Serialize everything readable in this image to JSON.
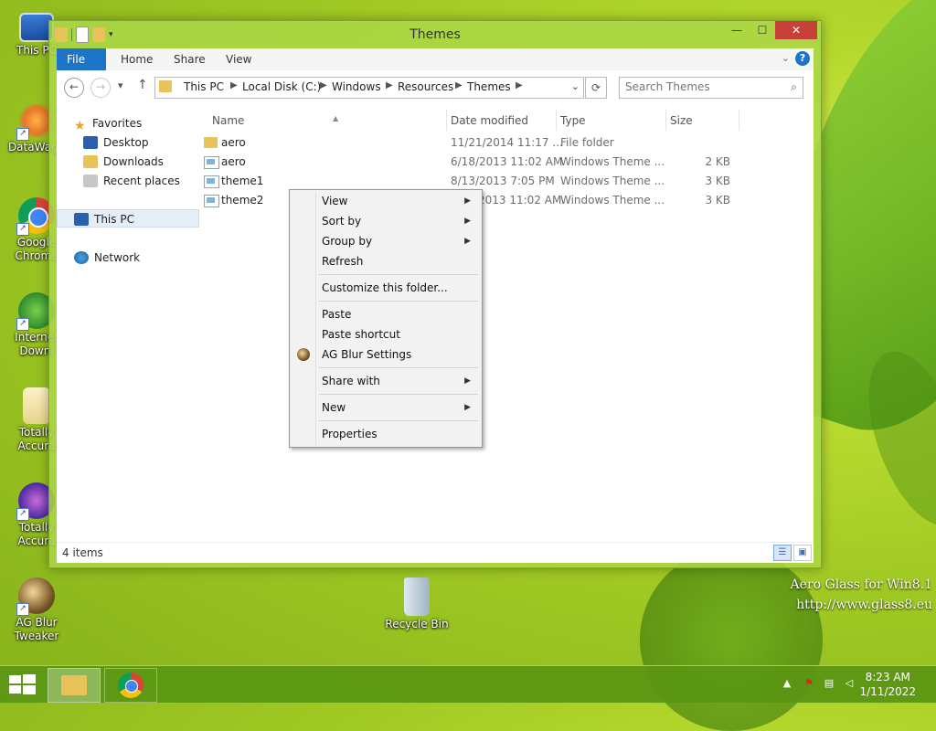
{
  "desktop": {
    "icons": [
      {
        "label": "This PC"
      },
      {
        "label": "DataWage"
      },
      {
        "label": "Google Chrome"
      },
      {
        "label": "Internet Downl"
      },
      {
        "label": "Totally Accura"
      },
      {
        "label": "Totally Accura"
      },
      {
        "label": "AG Blur Tweaker"
      },
      {
        "label": "Recycle Bin"
      }
    ],
    "watermark_line1": "Aero Glass for Win8.1",
    "watermark_line2": "http://www.glass8.eu"
  },
  "window": {
    "title": "Themes",
    "controls": {
      "minimize": "—",
      "maximize": "☐",
      "close": "✕"
    }
  },
  "ribbon": {
    "tabs": [
      "File",
      "Home",
      "Share",
      "View"
    ],
    "help": "?"
  },
  "addressbar": {
    "crumbs": [
      "This PC",
      "Local Disk (C:)",
      "Windows",
      "Resources",
      "Themes"
    ],
    "search_placeholder": "Search Themes"
  },
  "navpane": {
    "favorites": "Favorites",
    "desktop": "Desktop",
    "downloads": "Downloads",
    "recent": "Recent places",
    "thispc": "This PC",
    "network": "Network"
  },
  "filelist": {
    "columns": [
      "Name",
      "Date modified",
      "Type",
      "Size"
    ],
    "rows": [
      {
        "name": "aero",
        "date": "11/21/2014 11:17 ...",
        "type": "File folder",
        "size": "",
        "icon": "folder-icon"
      },
      {
        "name": "aero",
        "date": "6/18/2013 11:02 AM",
        "type": "Windows Theme ...",
        "size": "2 KB",
        "icon": "theme-file-icon"
      },
      {
        "name": "theme1",
        "date": "8/13/2013 7:05 PM",
        "type": "Windows Theme ...",
        "size": "3 KB",
        "icon": "theme-file-icon"
      },
      {
        "name": "theme2",
        "date": "2013 11:02 AM",
        "type": "Windows Theme ...",
        "size": "3 KB",
        "icon": "theme-file-icon"
      }
    ]
  },
  "status": {
    "items": "4 items"
  },
  "contextmenu": {
    "items": [
      {
        "label": "View",
        "submenu": true
      },
      {
        "label": "Sort by",
        "submenu": true
      },
      {
        "label": "Group by",
        "submenu": true
      },
      {
        "label": "Refresh",
        "submenu": false
      },
      {
        "label": "Customize this folder...",
        "submenu": false
      },
      {
        "label": "Paste",
        "submenu": false
      },
      {
        "label": "Paste shortcut",
        "submenu": false
      },
      {
        "label": "AG Blur Settings",
        "submenu": false
      },
      {
        "label": "Share with",
        "submenu": true
      },
      {
        "label": "New",
        "submenu": true
      },
      {
        "label": "Properties",
        "submenu": false
      }
    ]
  },
  "taskbar": {
    "time": "8:23 AM",
    "date": "1/11/2022"
  }
}
